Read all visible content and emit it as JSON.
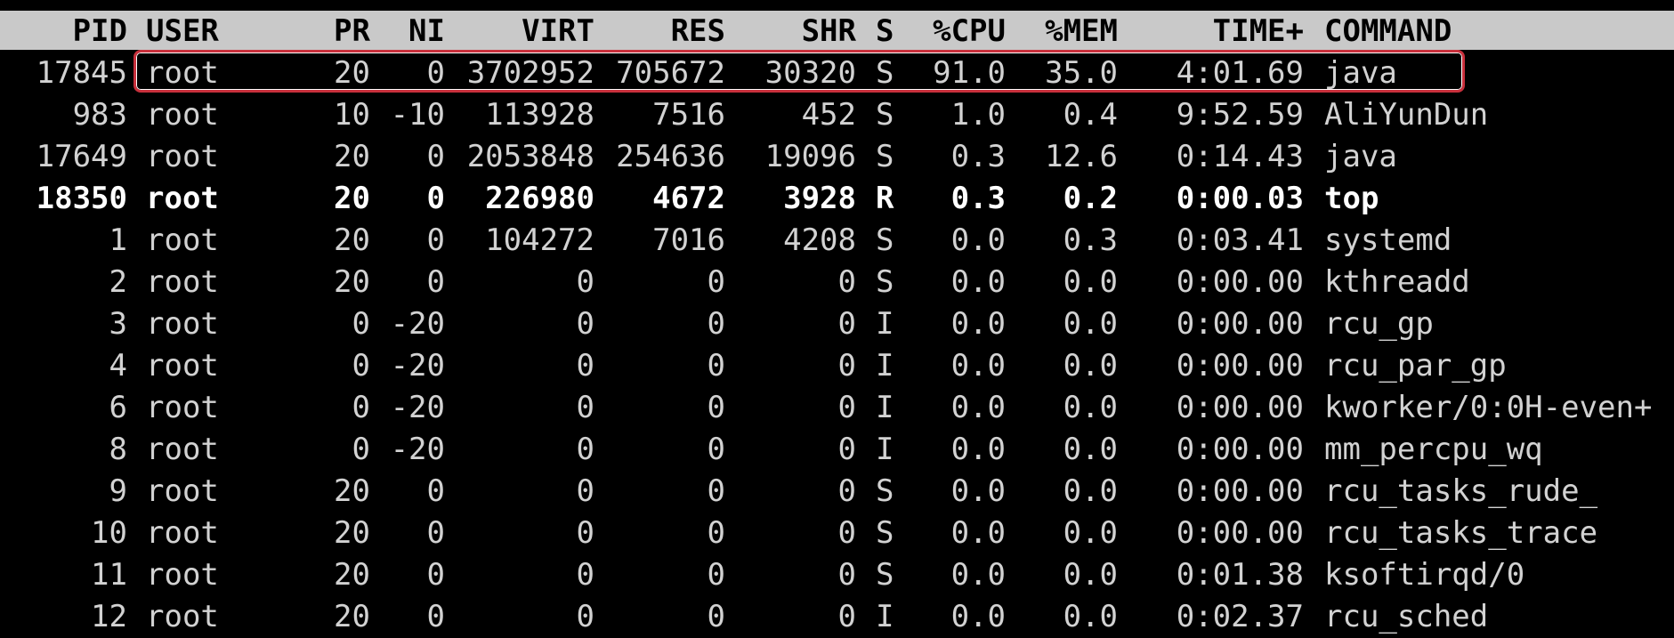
{
  "top": {
    "columns": [
      "PID",
      "USER",
      "PR",
      "NI",
      "VIRT",
      "RES",
      "SHR",
      "S",
      "%CPU",
      "%MEM",
      "TIME+",
      "COMMAND"
    ],
    "highlight_color": "#c8303c",
    "header_background": "#c9c9c9",
    "text_color": "#d2d2d2",
    "rows": [
      {
        "pid": "17845",
        "user": "root",
        "pr": "20",
        "ni": "0",
        "virt": "3702952",
        "res": "705672",
        "shr": "30320",
        "s": "S",
        "cpu": "91.0",
        "mem": "35.0",
        "time": "4:01.69",
        "cmd": "java",
        "highlighted": true
      },
      {
        "pid": "983",
        "user": "root",
        "pr": "10",
        "ni": "-10",
        "virt": "113928",
        "res": "7516",
        "shr": "452",
        "s": "S",
        "cpu": "1.0",
        "mem": "0.4",
        "time": "9:52.59",
        "cmd": "AliYunDun"
      },
      {
        "pid": "17649",
        "user": "root",
        "pr": "20",
        "ni": "0",
        "virt": "2053848",
        "res": "254636",
        "shr": "19096",
        "s": "S",
        "cpu": "0.3",
        "mem": "12.6",
        "time": "0:14.43",
        "cmd": "java"
      },
      {
        "pid": "18350",
        "user": "root",
        "pr": "20",
        "ni": "0",
        "virt": "226980",
        "res": "4672",
        "shr": "3928",
        "s": "R",
        "cpu": "0.3",
        "mem": "0.2",
        "time": "0:00.03",
        "cmd": "top",
        "bold": true
      },
      {
        "pid": "1",
        "user": "root",
        "pr": "20",
        "ni": "0",
        "virt": "104272",
        "res": "7016",
        "shr": "4208",
        "s": "S",
        "cpu": "0.0",
        "mem": "0.3",
        "time": "0:03.41",
        "cmd": "systemd"
      },
      {
        "pid": "2",
        "user": "root",
        "pr": "20",
        "ni": "0",
        "virt": "0",
        "res": "0",
        "shr": "0",
        "s": "S",
        "cpu": "0.0",
        "mem": "0.0",
        "time": "0:00.00",
        "cmd": "kthreadd"
      },
      {
        "pid": "3",
        "user": "root",
        "pr": "0",
        "ni": "-20",
        "virt": "0",
        "res": "0",
        "shr": "0",
        "s": "I",
        "cpu": "0.0",
        "mem": "0.0",
        "time": "0:00.00",
        "cmd": "rcu_gp"
      },
      {
        "pid": "4",
        "user": "root",
        "pr": "0",
        "ni": "-20",
        "virt": "0",
        "res": "0",
        "shr": "0",
        "s": "I",
        "cpu": "0.0",
        "mem": "0.0",
        "time": "0:00.00",
        "cmd": "rcu_par_gp"
      },
      {
        "pid": "6",
        "user": "root",
        "pr": "0",
        "ni": "-20",
        "virt": "0",
        "res": "0",
        "shr": "0",
        "s": "I",
        "cpu": "0.0",
        "mem": "0.0",
        "time": "0:00.00",
        "cmd": "kworker/0:0H-even+"
      },
      {
        "pid": "8",
        "user": "root",
        "pr": "0",
        "ni": "-20",
        "virt": "0",
        "res": "0",
        "shr": "0",
        "s": "I",
        "cpu": "0.0",
        "mem": "0.0",
        "time": "0:00.00",
        "cmd": "mm_percpu_wq"
      },
      {
        "pid": "9",
        "user": "root",
        "pr": "20",
        "ni": "0",
        "virt": "0",
        "res": "0",
        "shr": "0",
        "s": "S",
        "cpu": "0.0",
        "mem": "0.0",
        "time": "0:00.00",
        "cmd": "rcu_tasks_rude_"
      },
      {
        "pid": "10",
        "user": "root",
        "pr": "20",
        "ni": "0",
        "virt": "0",
        "res": "0",
        "shr": "0",
        "s": "S",
        "cpu": "0.0",
        "mem": "0.0",
        "time": "0:00.00",
        "cmd": "rcu_tasks_trace"
      },
      {
        "pid": "11",
        "user": "root",
        "pr": "20",
        "ni": "0",
        "virt": "0",
        "res": "0",
        "shr": "0",
        "s": "S",
        "cpu": "0.0",
        "mem": "0.0",
        "time": "0:01.38",
        "cmd": "ksoftirqd/0"
      },
      {
        "pid": "12",
        "user": "root",
        "pr": "20",
        "ni": "0",
        "virt": "0",
        "res": "0",
        "shr": "0",
        "s": "I",
        "cpu": "0.0",
        "mem": "0.0",
        "time": "0:02.37",
        "cmd": "rcu_sched"
      }
    ]
  }
}
